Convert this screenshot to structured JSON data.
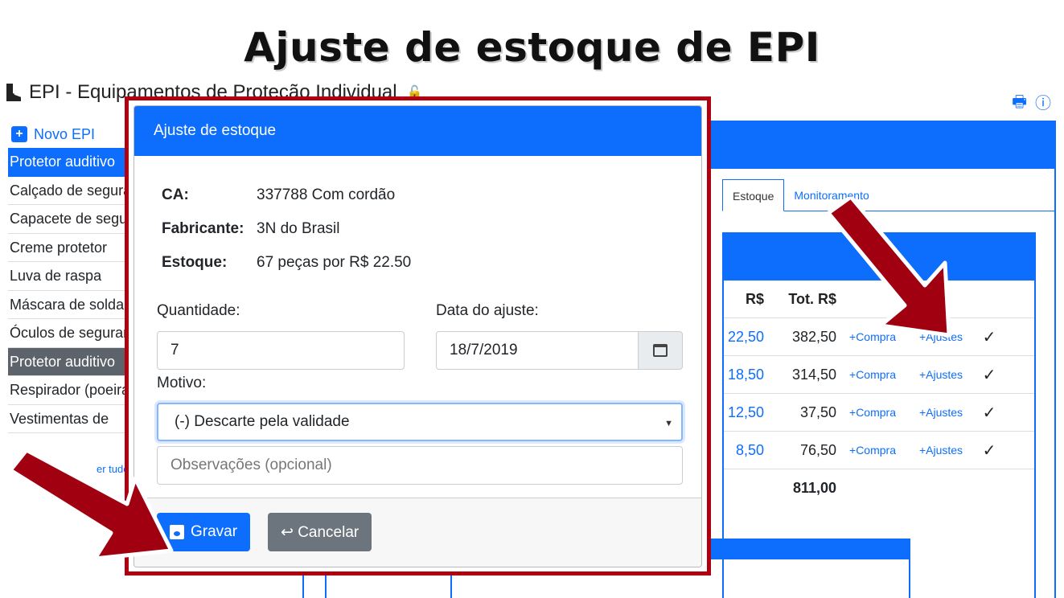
{
  "slide_title": "Ajuste de estoque de EPI",
  "app": {
    "title": "EPI - Equipamentos de Proteção Individual"
  },
  "left_list": {
    "new_label": "Novo EPI",
    "items": [
      "Protetor auditivo",
      "Calçado de segurança",
      "Capacete de segurança",
      "Creme protetor",
      "Luva de raspa",
      "Máscara de solda",
      "Óculos de segurança",
      "Protetor auditivo",
      "Respirador (poeira)",
      "Vestimentas de"
    ],
    "show_all": "er tudo"
  },
  "tabs": [
    "Estoque",
    "Monitoramento"
  ],
  "table": {
    "headers": [
      "R$",
      "Tot. R$"
    ],
    "rows": [
      {
        "price": "22,50",
        "total": "382,50",
        "buy": "+Compra",
        "adjust": "+Ajustes"
      },
      {
        "price": "18,50",
        "total": "314,50",
        "buy": "+Compra",
        "adjust": "+Ajustes"
      },
      {
        "price": "12,50",
        "total": "37,50",
        "buy": "+Compra",
        "adjust": "+Ajustes"
      },
      {
        "price": "8,50",
        "total": "76,50",
        "buy": "+Compra",
        "adjust": "+Ajustes"
      }
    ],
    "grand_total": "811,00"
  },
  "modal": {
    "title": "Ajuste de estoque",
    "ca_label": "CA:",
    "ca_value": "337788 Com cordão",
    "maker_label": "Fabricante:",
    "maker_value": "3N do Brasil",
    "stock_label": "Estoque:",
    "stock_value": "67 peças por R$ 22.50",
    "qty_label": "Quantidade:",
    "qty_value": "7",
    "date_label": "Data do ajuste:",
    "date_value": "18/7/2019",
    "reason_label": "Motivo:",
    "reason_value": "(-) Descarte pela validade",
    "notes_placeholder": "Observações (opcional)",
    "save_label": "Gravar",
    "cancel_label": "↩ Cancelar"
  },
  "colors": {
    "primary": "#0d6efd",
    "highlight": "#b00010",
    "secondary": "#6c757d"
  }
}
